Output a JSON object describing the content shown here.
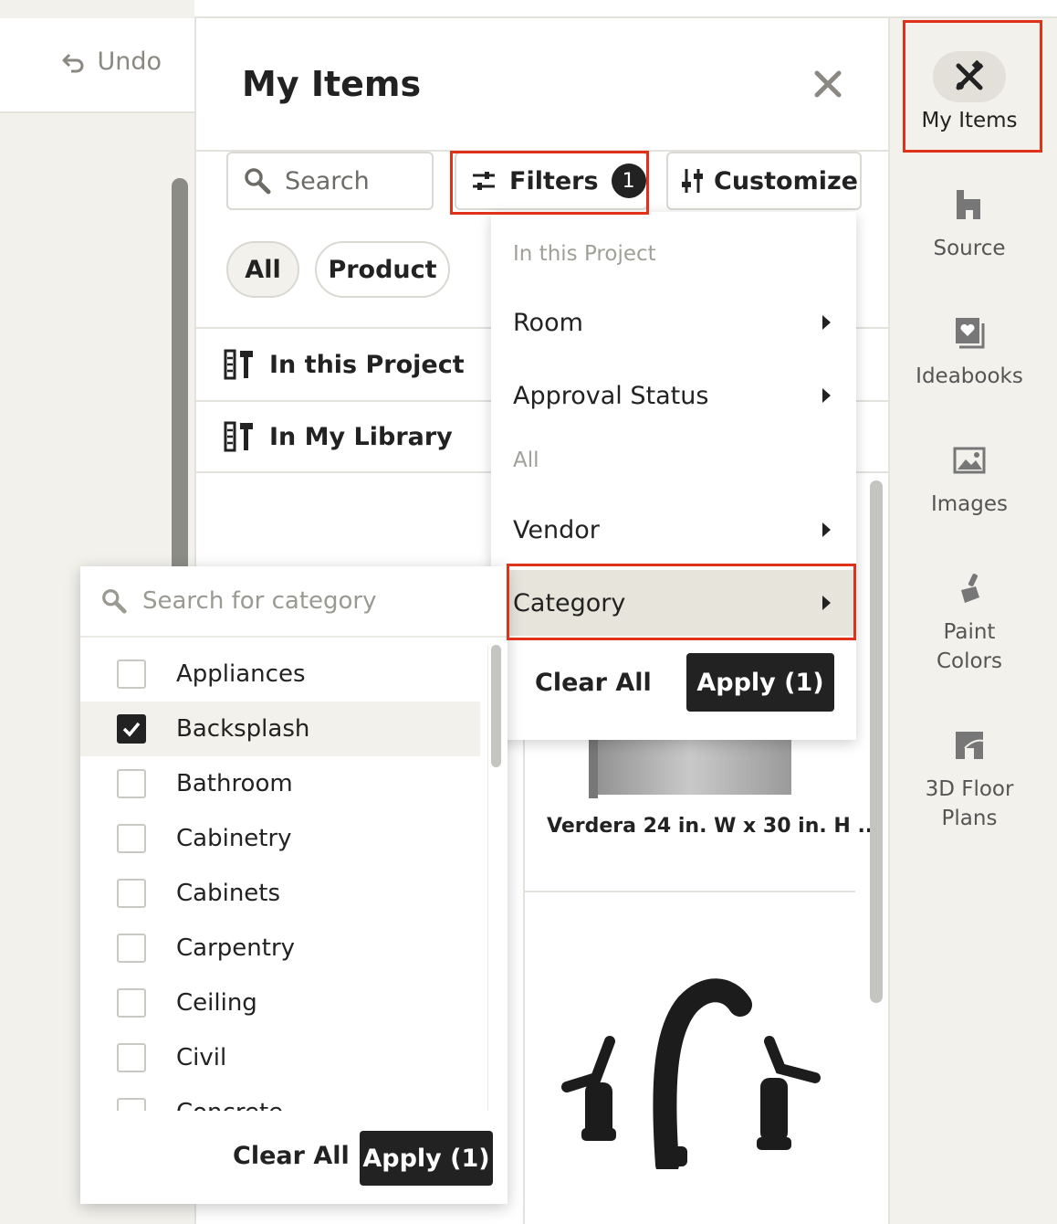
{
  "toolbar": {
    "undo_label": "Undo"
  },
  "panel": {
    "title": "My Items",
    "search_placeholder": "Search",
    "filters_label": "Filters",
    "filters_count": "1",
    "customize_label": "Customize",
    "chips": [
      "All",
      "Product"
    ],
    "sections": [
      "In this Project",
      "In My Library"
    ],
    "product_title": "Verdera 24 in. W x 30 in. H ..."
  },
  "filters_menu": {
    "heading_project": "In this Project",
    "room": "Room",
    "approval_status": "Approval Status",
    "heading_all": "All",
    "vendor": "Vendor",
    "category": "Category",
    "clear_all": "Clear All",
    "apply": "Apply (1)"
  },
  "category_menu": {
    "search_placeholder": "Search for category",
    "items": [
      {
        "label": "Appliances",
        "checked": false
      },
      {
        "label": "Backsplash",
        "checked": true
      },
      {
        "label": "Bathroom",
        "checked": false
      },
      {
        "label": "Cabinetry",
        "checked": false
      },
      {
        "label": "Cabinets",
        "checked": false
      },
      {
        "label": "Carpentry",
        "checked": false
      },
      {
        "label": "Ceiling",
        "checked": false
      },
      {
        "label": "Civil",
        "checked": false
      },
      {
        "label": "Concrete",
        "checked": false
      }
    ],
    "clear_all": "Clear All",
    "apply": "Apply (1)"
  },
  "rail": {
    "items": [
      {
        "label": "My Items",
        "icon": "tools-icon",
        "active": true
      },
      {
        "label": "Source",
        "icon": "source-icon",
        "active": false
      },
      {
        "label": "Ideabooks",
        "icon": "ideabook-icon",
        "active": false
      },
      {
        "label": "Images",
        "icon": "image-icon",
        "active": false
      },
      {
        "label": "Paint Colors",
        "icon": "paintbrush-icon",
        "active": false
      },
      {
        "label": "3D Floor Plans",
        "icon": "floorplan-icon",
        "active": false
      }
    ]
  },
  "colors": {
    "accent": "#222222",
    "highlight": "#e0311a",
    "background": "#f2f1ec"
  }
}
